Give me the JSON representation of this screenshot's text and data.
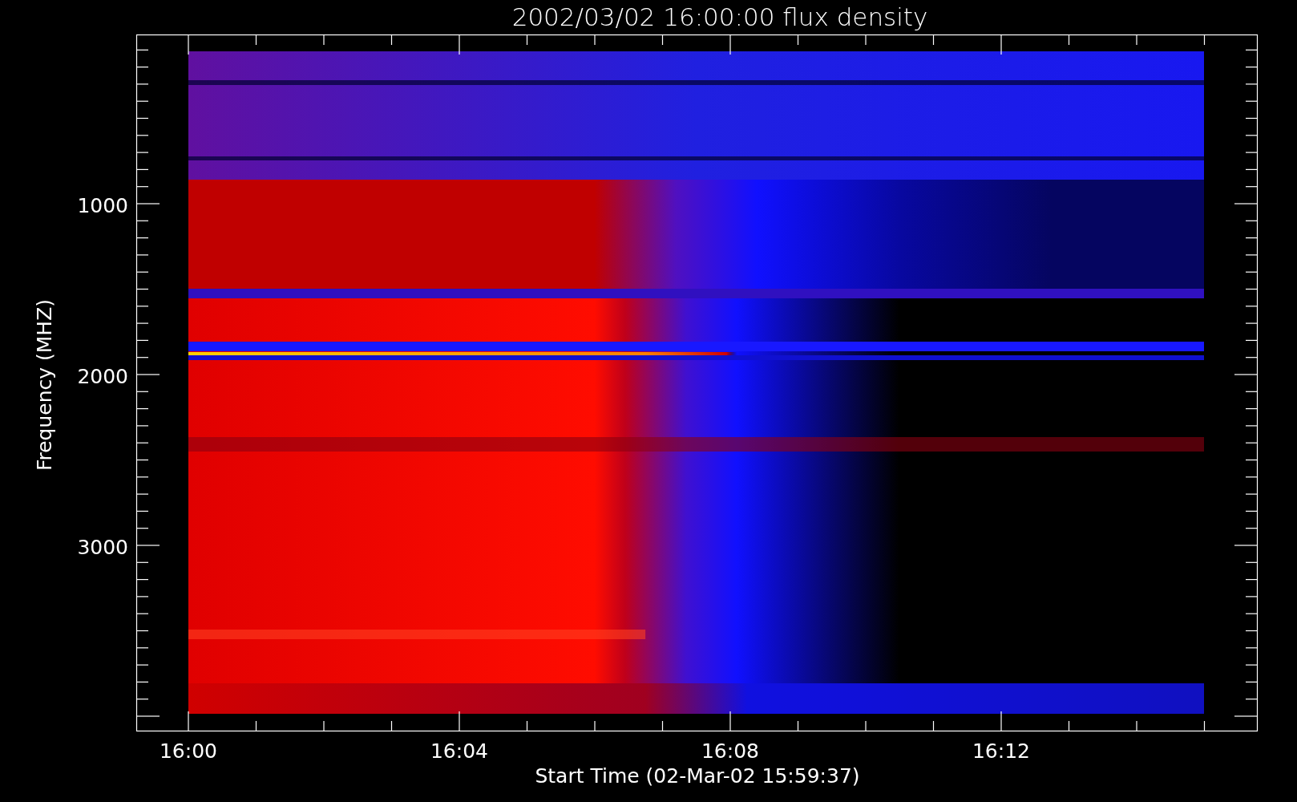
{
  "plot": {
    "title": "2002/03/02 16:00:00 flux density",
    "ylabel": "Frequency (MHZ)",
    "xlabel": "Start Time (02-Mar-02 15:59:37)",
    "yticks": [
      "1000",
      "2000",
      "3000"
    ],
    "xticks": [
      "16:00",
      "16:04",
      "16:08",
      "16:12"
    ]
  }
}
